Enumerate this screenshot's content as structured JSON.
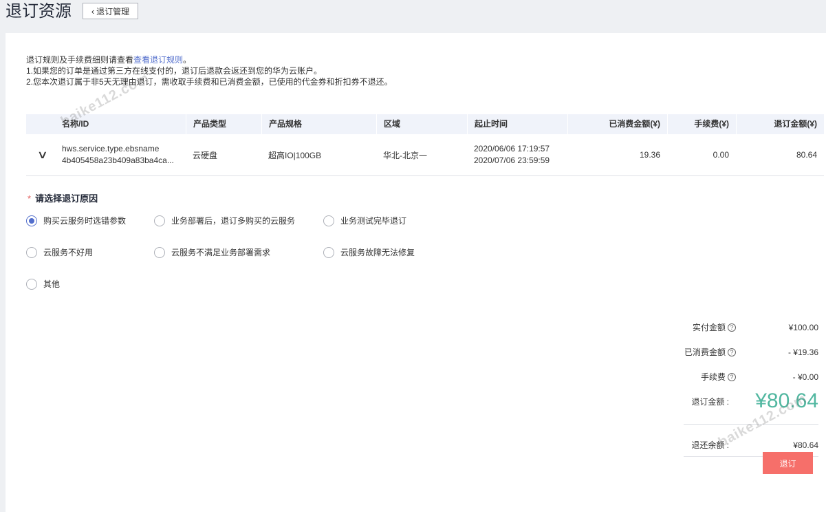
{
  "header": {
    "title": "退订资源",
    "back_label": "退订管理"
  },
  "notice": {
    "line1_prefix": "退订规则及手续费细则请查看",
    "line1_link": "查看退订规则",
    "line1_suffix": "。",
    "line2": "1.如果您的订单是通过第三方在线支付的，退订后退款会返还到您的华为云账户。",
    "line3": "2.您本次退订属于非5天无理由退订，需收取手续费和已消费金额，已使用的代金券和折扣券不退还。"
  },
  "table": {
    "headers": [
      "名称/ID",
      "产品类型",
      "产品规格",
      "区域",
      "起止时间",
      "已消费金额(¥)",
      "手续费(¥)",
      "退订金额(¥)"
    ],
    "row": {
      "name": "hws.service.type.ebsname",
      "id": "4b405458a23b409a83ba4ca...",
      "type": "云硬盘",
      "spec": "超高IO|100GB",
      "region": "华北-北京一",
      "start": "2020/06/06 17:19:57",
      "end": "2020/07/06 23:59:59",
      "consumed": "19.36",
      "fee": "0.00",
      "refund": "80.64"
    }
  },
  "reasons": {
    "title": "请选择退订原因",
    "required_mark": "*",
    "options": [
      "购买云服务时选错参数",
      "业务部署后，退订多购买的云服务",
      "业务测试完毕退订",
      "云服务不好用",
      "云服务不满足业务部署需求",
      "云服务故障无法修复",
      "其他"
    ],
    "selected_index": 0
  },
  "summary": {
    "paid_label": "实付金额",
    "paid_value": "¥100.00",
    "consumed_label": "已消费金额",
    "consumed_value": "- ¥19.36",
    "fee_label": "手续费",
    "fee_value": "- ¥0.00",
    "refund_label": "退订金额 :",
    "refund_value": "¥80.64",
    "balance_label": "退还余额 :",
    "balance_value": "¥80.64"
  },
  "watermark": "baike112.com",
  "submit_label": "退订"
}
